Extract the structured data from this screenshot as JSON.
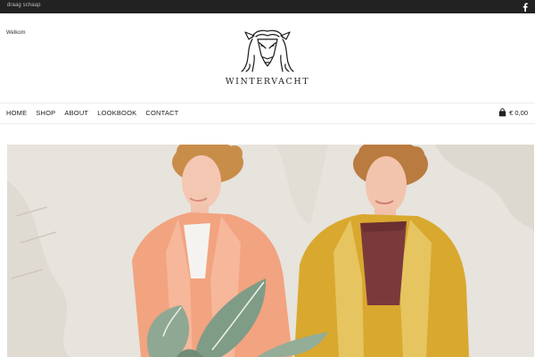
{
  "topbar": {
    "tagline": "draag schaap",
    "social_icon": "facebook-icon"
  },
  "header": {
    "welcome_text": "Welkom",
    "brand": "WINTERVACHT",
    "logo_icon": "sheep-head-logo-icon"
  },
  "nav": {
    "items": [
      {
        "label": "HOME"
      },
      {
        "label": "SHOP"
      },
      {
        "label": "ABOUT"
      },
      {
        "label": "LOOKBOOK"
      },
      {
        "label": "CONTACT"
      }
    ]
  },
  "cart": {
    "icon": "shopping-bag-icon",
    "total": "€ 0,00"
  },
  "colors": {
    "topbar_bg": "#222222",
    "coat_left": "#f2a37f",
    "coat_right": "#d9a82e",
    "wall": "#e9e5df"
  }
}
